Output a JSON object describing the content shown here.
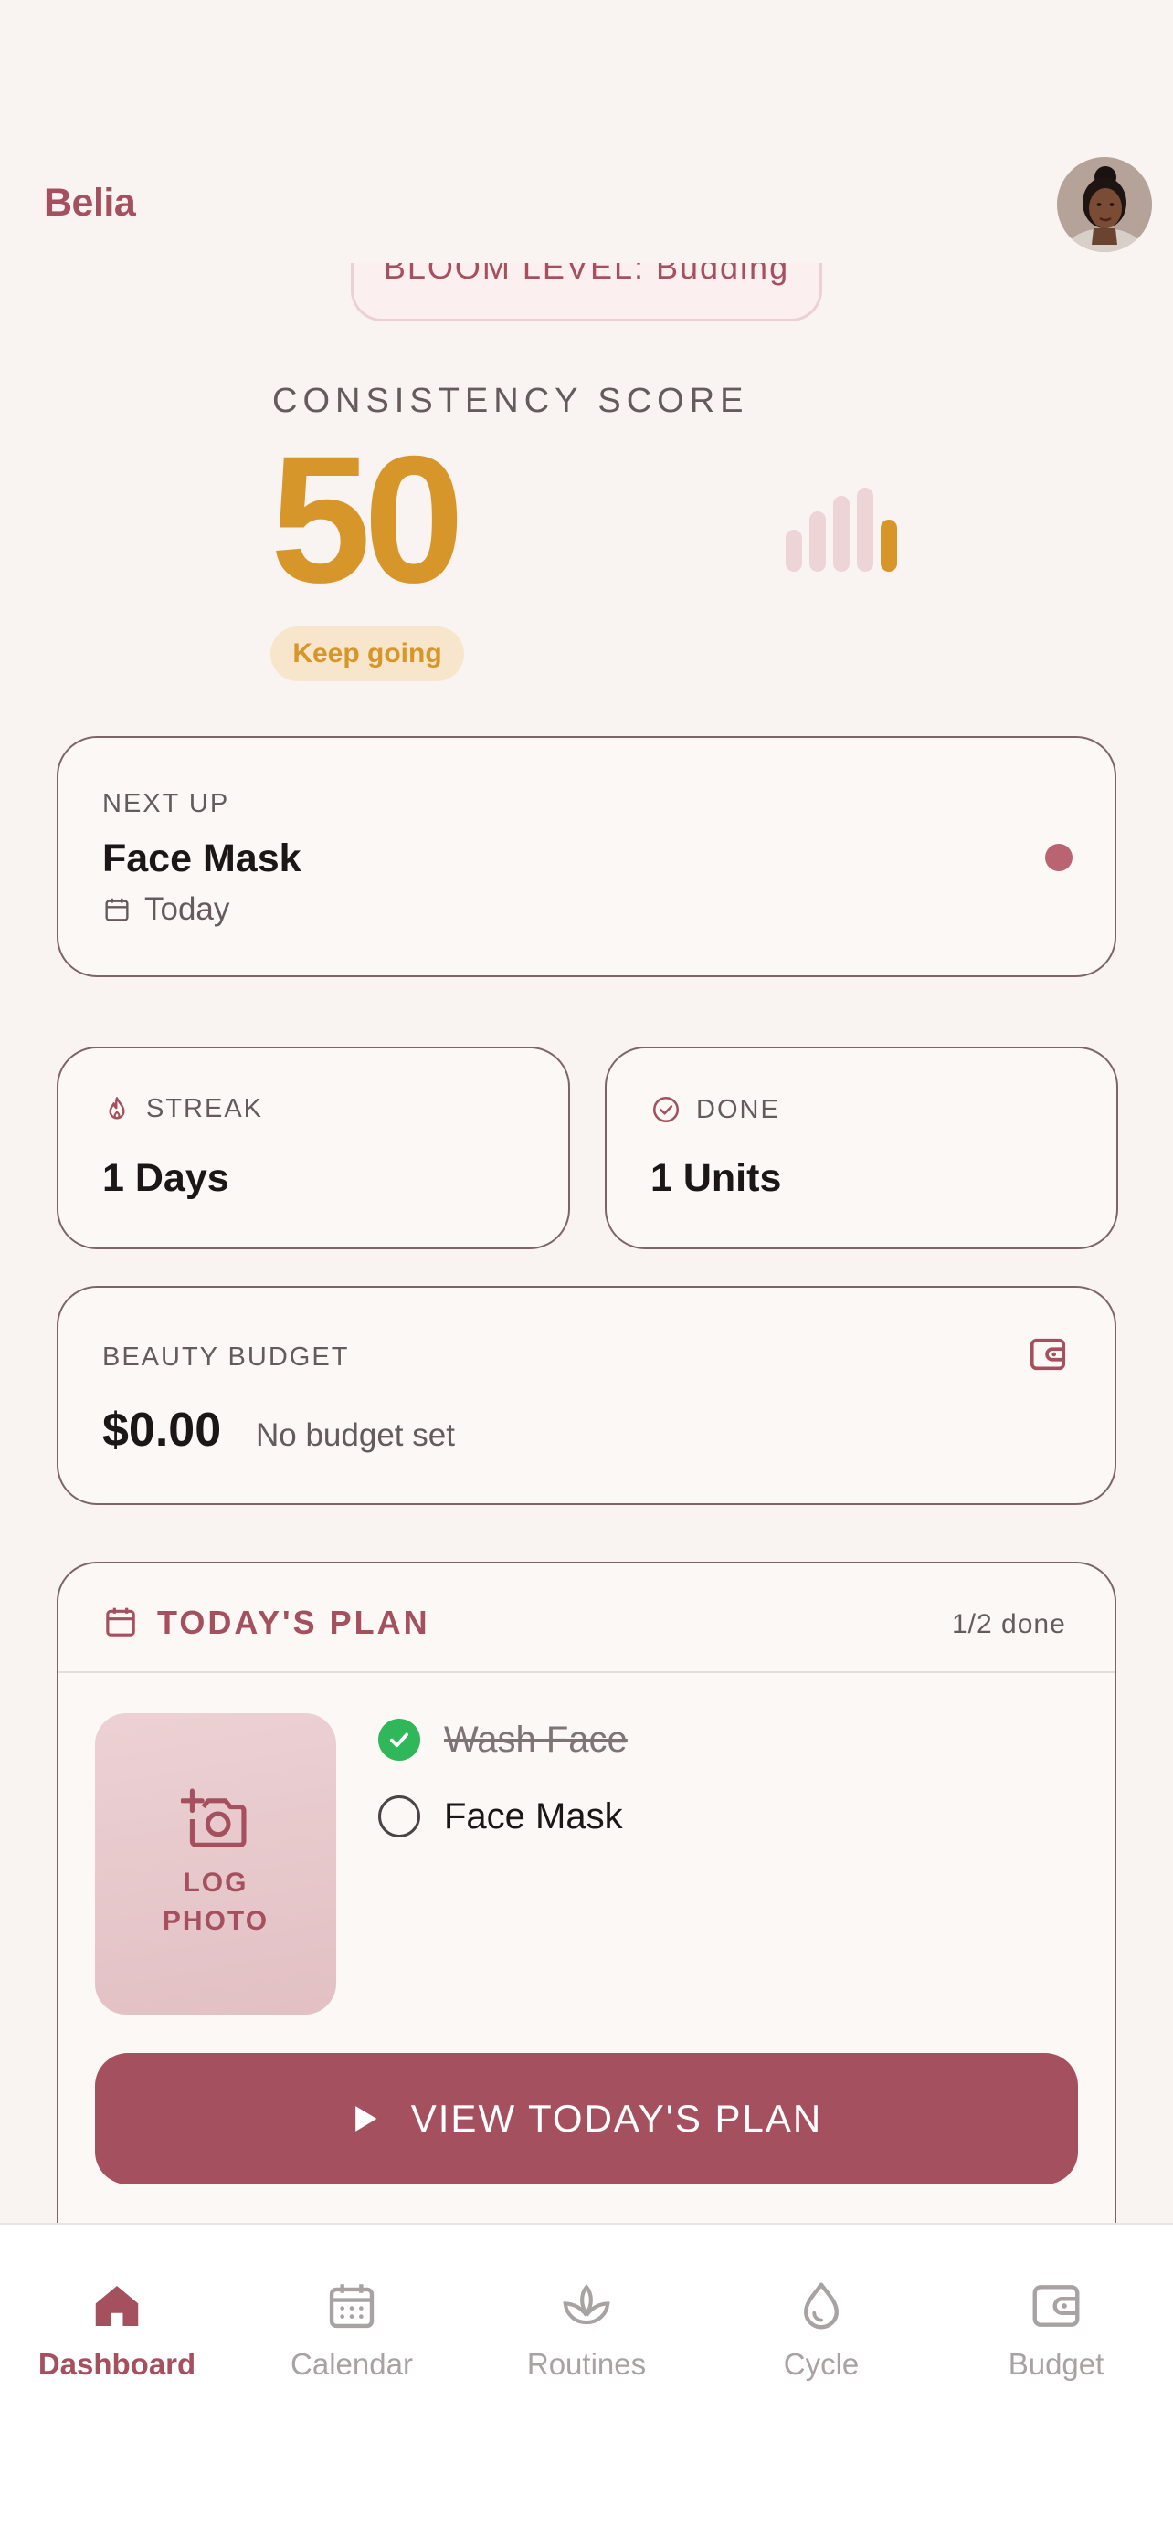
{
  "header": {
    "brand": "Belia",
    "avatar_icon": "user-avatar-photo"
  },
  "bloom": {
    "label": "BLOOM LEVEL: Budding"
  },
  "score": {
    "label": "CONSISTENCY SCORE",
    "value": "50",
    "badge": "Keep going",
    "bar_levels": [
      0.5,
      0.72,
      0.9,
      1.0,
      0.62
    ],
    "accent_color": "#d6962a"
  },
  "next_up": {
    "caption": "NEXT UP",
    "title": "Face Mask",
    "date": "Today",
    "dot_color": "#b96470"
  },
  "stats": {
    "streak": {
      "label": "STREAK",
      "value": "1 Days",
      "icon": "flame-icon"
    },
    "done": {
      "label": "DONE",
      "value": "1 Units",
      "icon": "check-circle-icon"
    }
  },
  "budget": {
    "caption": "BEAUTY BUDGET",
    "amount": "$0.00",
    "note": "No budget set",
    "icon": "wallet-icon"
  },
  "plan": {
    "title": "TODAY'S PLAN",
    "progress": "1/2 done",
    "log_photo_line1": "LOG",
    "log_photo_line2": "PHOTO",
    "tasks": [
      {
        "label": "Wash Face",
        "done": true
      },
      {
        "label": "Face Mask",
        "done": false
      }
    ],
    "button_label": "VIEW TODAY'S PLAN"
  },
  "nav": {
    "items": [
      {
        "label": "Dashboard",
        "icon": "home-icon",
        "active": true
      },
      {
        "label": "Calendar",
        "icon": "calendar-icon",
        "active": false
      },
      {
        "label": "Routines",
        "icon": "lotus-icon",
        "active": false
      },
      {
        "label": "Cycle",
        "icon": "drop-icon",
        "active": false
      },
      {
        "label": "Budget",
        "icon": "wallet-icon",
        "active": false
      }
    ]
  },
  "colors": {
    "brand": "#a5505e",
    "background": "#f9f4f1",
    "success": "#2fb759"
  }
}
